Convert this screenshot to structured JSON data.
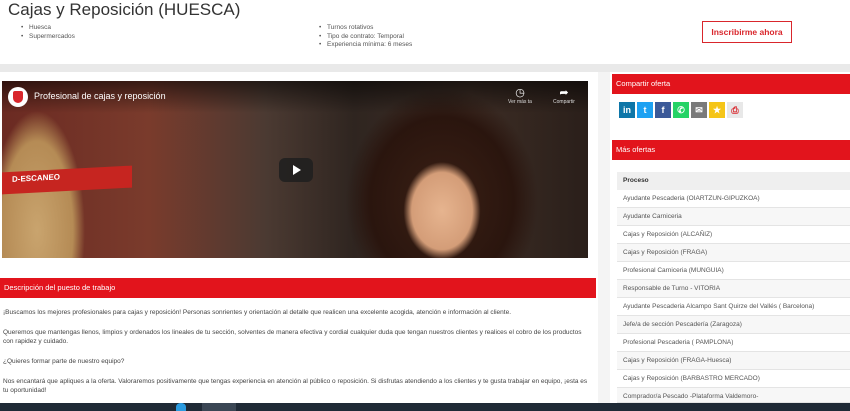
{
  "header": {
    "title": "Cajas y Reposición (HUESCA)",
    "bullets_left": [
      "Huesca",
      "Supermercados"
    ],
    "bullets_mid": [
      "Turnos rotativos",
      "Tipo de contrato: Temporal",
      "Experiencia mínima: 6 meses"
    ],
    "apply_label": "Inscribirme ahora"
  },
  "video": {
    "title": "Profesional de cajas y reposición",
    "banner_text": "D-ESCANEO",
    "watch_later_label": "Ver más ta",
    "share_label": "Compartir",
    "icons": {
      "watch_later": "clock-icon",
      "share": "share-arrow-icon",
      "play": "play-icon"
    }
  },
  "description": {
    "heading": "Descripción del puesto de trabajo",
    "paragraphs": [
      "¡Buscamos los mejores profesionales para cajas y reposición! Personas sonrientes y orientación al detalle que realicen una excelente acogida, atención e información al cliente.",
      "Queremos que mantengas llenos, limpios y ordenados los lineales de tu sección, solventes de manera efectiva y cordial cualquier duda que tengan nuestros clientes y realices el cobro de los productos con rapidez y cuidado.",
      "¿Quieres formar parte de nuestro equipo?",
      "Nos encantará que apliques a la oferta. Valoraremos positivamente que tengas experiencia en atención al público o reposición. Si disfrutas atendiendo a los clientes y te gusta trabajar en equipo, ¡esta es tu oportunidad!"
    ]
  },
  "share": {
    "heading": "Compartir oferta",
    "icons": [
      {
        "name": "linkedin-icon",
        "glyph": "in",
        "color": "#0e76a8"
      },
      {
        "name": "twitter-icon",
        "glyph": "t",
        "color": "#1da1f2"
      },
      {
        "name": "facebook-icon",
        "glyph": "f",
        "color": "#3b5998"
      },
      {
        "name": "whatsapp-icon",
        "glyph": "✆",
        "color": "#25d366"
      },
      {
        "name": "email-icon",
        "glyph": "✉",
        "color": "#7a7a7a"
      },
      {
        "name": "favorite-star-icon",
        "glyph": "★",
        "color": "#f5c518"
      },
      {
        "name": "print-icon",
        "glyph": "⎙",
        "color": "#e8e8e8"
      }
    ]
  },
  "more_offers": {
    "heading": "Más ofertas",
    "column_header": "Proceso",
    "items": [
      "Ayudante Pescaderia (OIARTZUN-GIPUZKOA)",
      "Ayudante Carniceria",
      "Cajas y Reposición (ALCAÑIZ)",
      "Cajas y Reposición (FRAGA)",
      "Profesional Carniceria (MUNGUIA)",
      "Responsable de Turno - VITORIA",
      "Ayudante Pescaderia Alcampo Sant Quirze del Vallés ( Barcelona)",
      "Jefe/a de sección Pescadería (Zaragoza)",
      "Profesional Pescaderia ( PAMPLONA)",
      "Cajas y Reposición (FRAGA-Huesca)",
      "Cajas y Reposición (BARBASTRO MERCADO)",
      "Comprador/a Pescado -Plataforma Valdemoro-"
    ]
  }
}
